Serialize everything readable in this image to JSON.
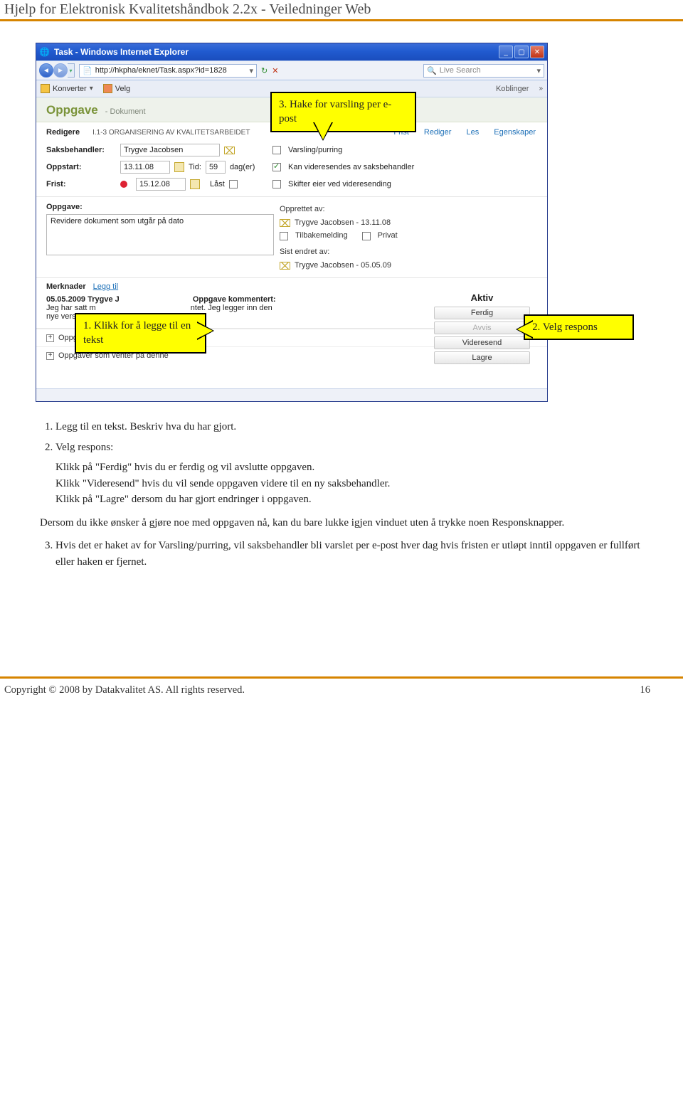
{
  "page_header": "Hjelp for Elektronisk Kvalitetshåndbok 2.2x - Veiledninger Web",
  "ie": {
    "title": "Task - Windows Internet Explorer",
    "url": "http://hkpha/eknet/Task.aspx?id=1828",
    "search_placeholder": "Live Search",
    "toolbar": {
      "konverter": "Konverter",
      "velg": "Velg",
      "koblinger": "Koblinger"
    }
  },
  "app": {
    "title": "Oppgave",
    "subtitle": "-  Dokument",
    "edit_label": "Redigere",
    "doc_title": "I.1-3 ORGANISERING AV KVALITETSARBEIDET",
    "tabs": {
      "frist": "Frist",
      "rediger": "Rediger",
      "les": "Les",
      "egenskaper": "Egenskaper"
    },
    "labels": {
      "saksbehandler": "Saksbehandler:",
      "oppstart": "Oppstart:",
      "frist": "Frist:",
      "tid": "Tid:",
      "dag": "dag(er)",
      "last": "Låst",
      "varsling": "Varsling/purring",
      "videresend": "Kan videresendes av saksbehandler",
      "skifter": "Skifter eier ved videresending",
      "oppgave": "Oppgave:",
      "opprettet": "Opprettet av:",
      "tilbakemelding": "Tilbakemelding",
      "privat": "Privat",
      "sist_endret": "Sist endret av:"
    },
    "values": {
      "saksbehandler": "Trygve Jacobsen",
      "oppstart": "13.11.08",
      "frist_dato": "15.12.08",
      "tid": "59",
      "oppgave_text": "Revidere dokument som utgår på dato",
      "opprettet_av": "Trygve Jacobsen - 13.11.08",
      "sist_endret_av": "Trygve Jacobsen - 05.05.09"
    },
    "merknader": {
      "title": "Merknader",
      "legg_til": "Legg til",
      "line1_bold": "05.05.2009 Trygve J",
      "line1_title": "Oppgave kommentert:",
      "line2": "Jeg har satt m",
      "line2b": "ntet. Jeg legger inn den",
      "line3": "nye versjonen s"
    },
    "response": {
      "title": "Aktiv",
      "ferdig": "Ferdig",
      "avvis": "Avvis",
      "videresend": "Videresend",
      "lagre": "Lagre"
    },
    "expanders": {
      "e1": "Oppgaver som denne venter på",
      "e2": "Oppgaver som venter på denne"
    }
  },
  "callouts": {
    "c1": "3. Hake for varsling per e-post",
    "c2": "1. Klikk for å legge til en tekst",
    "c3": "2. Velg respons"
  },
  "body": {
    "l1": "Legg til en tekst. Beskriv hva du har gjort.",
    "l2": "Velg respons:",
    "r1": "Klikk på \"Ferdig\" hvis du er ferdig og vil avslutte oppgaven.",
    "r2": "Klikk \"Videresend\" hvis du vil sende oppgaven videre til en ny saksbehandler.",
    "r3": "Klikk på \"Lagre\" dersom du har gjort endringer i oppgaven.",
    "p1": "Dersom du ikke ønsker å gjøre noe med oppgaven nå, kan du bare lukke igjen vinduet uten å trykke noen Responsknapper.",
    "l3": "Hvis det er haket av for Varsling/purring, vil saksbehandler bli varslet per e-post hver dag hvis fristen er utløpt inntil oppgaven er fullført eller haken er fjernet."
  },
  "footer": {
    "copyright": "Copyright © 2008 by Datakvalitet AS. All rights reserved.",
    "page": "16"
  }
}
